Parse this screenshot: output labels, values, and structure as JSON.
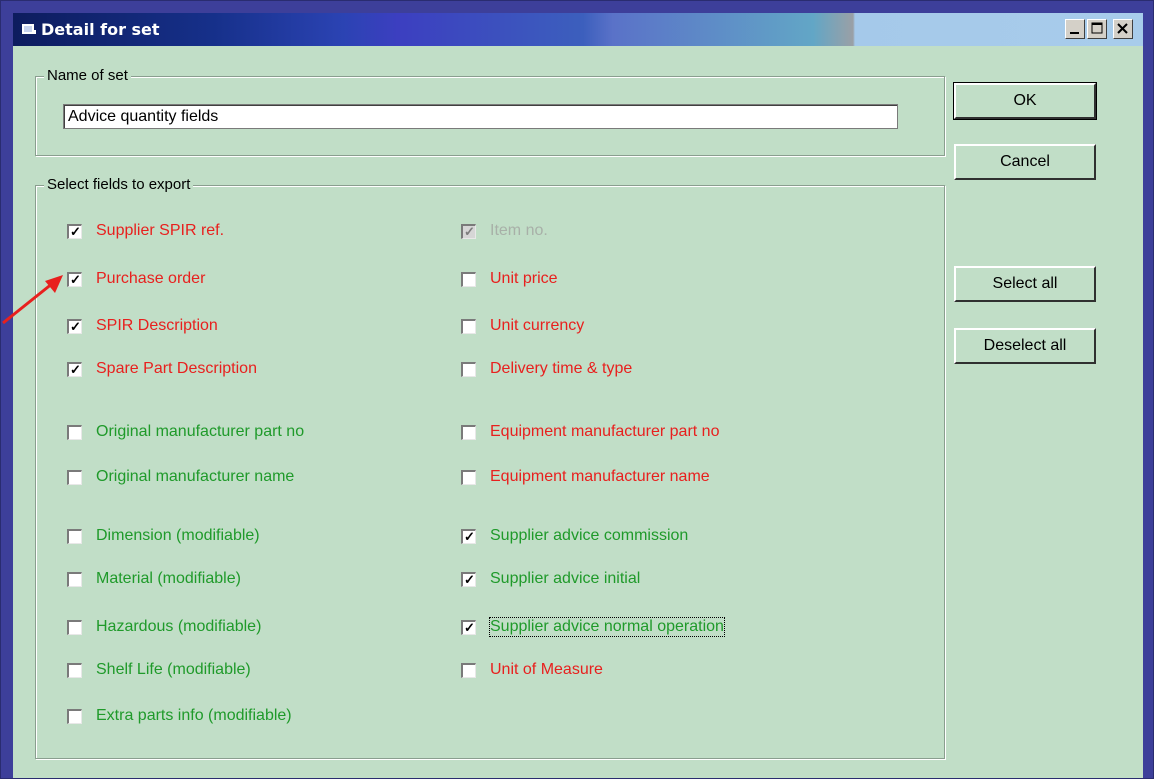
{
  "window": {
    "title": "Detail for set"
  },
  "name_group": {
    "legend": "Name of set",
    "value": "Advice quantity fields"
  },
  "buttons": {
    "ok": "OK",
    "cancel": "Cancel",
    "select_all": "Select all",
    "deselect_all": "Deselect all"
  },
  "fields_group": {
    "legend": "Select fields to export",
    "left": [
      {
        "label": "Supplier SPIR ref.",
        "checked": true,
        "color": "red"
      },
      {
        "label": "Purchase order",
        "checked": true,
        "color": "red"
      },
      {
        "label": "SPIR Description",
        "checked": true,
        "color": "red"
      },
      {
        "label": "Spare Part Description",
        "checked": true,
        "color": "red"
      },
      {
        "label": "Original manufacturer part no",
        "checked": false,
        "color": "green"
      },
      {
        "label": "Original manufacturer name",
        "checked": false,
        "color": "green"
      },
      {
        "label": "Dimension (modifiable)",
        "checked": false,
        "color": "green"
      },
      {
        "label": "Material (modifiable)",
        "checked": false,
        "color": "green"
      },
      {
        "label": "Hazardous (modifiable)",
        "checked": false,
        "color": "green"
      },
      {
        "label": "Shelf Life (modifiable)",
        "checked": false,
        "color": "green"
      },
      {
        "label": "Extra parts info (modifiable)",
        "checked": false,
        "color": "green"
      }
    ],
    "right": [
      {
        "label": "Item no.",
        "checked": true,
        "disabled": true,
        "color": "gray"
      },
      {
        "label": "Unit price",
        "checked": false,
        "color": "red"
      },
      {
        "label": "Unit currency",
        "checked": false,
        "color": "red"
      },
      {
        "label": "Delivery time & type",
        "checked": false,
        "color": "red"
      },
      {
        "label": "Equipment manufacturer part no",
        "checked": false,
        "color": "red"
      },
      {
        "label": "Equipment manufacturer name",
        "checked": false,
        "color": "red"
      },
      {
        "label": "Supplier advice commission",
        "checked": true,
        "color": "green"
      },
      {
        "label": "Supplier advice initial",
        "checked": true,
        "color": "green"
      },
      {
        "label": "Supplier advice normal operation",
        "checked": true,
        "color": "green",
        "focused": true
      },
      {
        "label": "Unit of Measure",
        "checked": false,
        "color": "red"
      }
    ]
  },
  "colors": {
    "red_label": "#e8201e",
    "green_label": "#1f9a2a",
    "gray_label": "#a8b0a8",
    "dialog_bg": "#c1dec7",
    "annotation_arrow": "#e8201e"
  },
  "icons": {
    "window_icon": "app-icon",
    "minimize": "minimize-icon",
    "maximize": "maximize-icon",
    "close": "close-icon"
  }
}
